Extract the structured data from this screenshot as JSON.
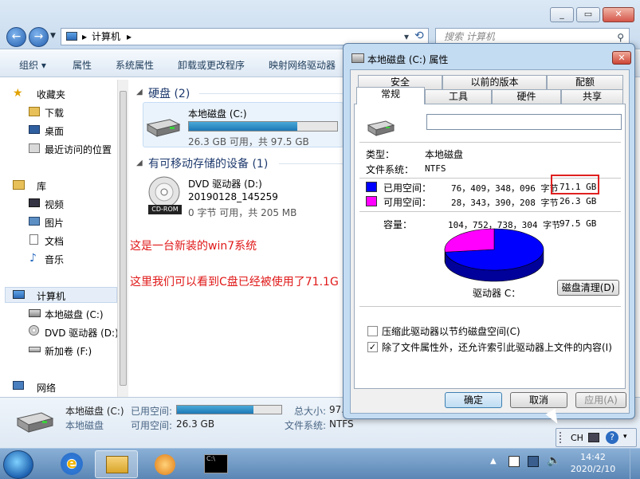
{
  "explorer": {
    "breadcrumb": "计算机",
    "search_placeholder": "搜索 计算机",
    "toolbar": [
      "组织 ▾",
      "属性",
      "系统属性",
      "卸载或更改程序",
      "映射网络驱动器"
    ],
    "nav": {
      "favorites": "收藏夹",
      "downloads": "下载",
      "desktop": "桌面",
      "recent": "最近访问的位置",
      "libraries": "库",
      "videos": "视频",
      "pictures": "图片",
      "documents": "文档",
      "music": "音乐",
      "computer": "计算机",
      "drive_c": "本地磁盘 (C:)",
      "drive_d": "DVD 驱动器 (D:)",
      "drive_f": "新加卷 (F:)",
      "network": "网络"
    },
    "groups": {
      "hdd": "硬盘 (2)",
      "removable": "有可移动存储的设备 (1)"
    },
    "drive_c": {
      "name": "本地磁盘 (C:)",
      "free_text": "26.3 GB 可用，共 97.5 GB",
      "used_fraction": 0.73
    },
    "drive_d": {
      "name": "DVD 驱动器 (D:)",
      "label": "20190128_145259",
      "free_text": "0 字节 可用，共 205 MB",
      "disc_caption": "CD-ROM"
    },
    "notes": [
      "这是一台新装的win7系统",
      "这里我们可以看到C盘已经被使用了71.1G"
    ],
    "details": {
      "name": "本地磁盘 (C:)",
      "type": "本地磁盘",
      "used_label": "已用空间:",
      "free_label": "可用空间:",
      "free_value": "26.3 GB",
      "total_label": "总大小:",
      "total_value": "97.",
      "fs_label": "文件系统:",
      "fs_value": "NTFS",
      "used_fraction": 0.73
    }
  },
  "dialog": {
    "title": "本地磁盘 (C:) 属性",
    "tabs_back": [
      "安全",
      "以前的版本",
      "配额"
    ],
    "tabs_front": [
      "常规",
      "工具",
      "硬件",
      "共享"
    ],
    "label_value": "",
    "type_label": "类型：",
    "type_value": "本地磁盘",
    "fs_label": "文件系统：",
    "fs_value": "NTFS",
    "used_label": "已用空间：",
    "used_bytes": "76，409，348，096 字节",
    "used_gb": "71.1 GB",
    "free_label": "可用空间：",
    "free_bytes": "28，343，390，208 字节",
    "free_gb": "26.3 GB",
    "cap_label": "容量：",
    "cap_bytes": "104，752，738，304 字节",
    "cap_gb": "97.5 GB",
    "drive_caption": "驱动器 C：",
    "cleanup_button": "磁盘清理(D)",
    "compress_label": "压缩此驱动器以节约磁盘空间(C)",
    "index_label": "除了文件属性外，还允许索引此驱动器上文件的内容(I)",
    "ok": "确定",
    "cancel": "取消",
    "apply": "应用(A)",
    "colors": {
      "used": "#0000ff",
      "free": "#ff00ff",
      "highlight": "#e02020"
    }
  },
  "chart_data": {
    "type": "pie",
    "categories": [
      "已用空间",
      "可用空间"
    ],
    "values": [
      76409348096,
      28343390208
    ],
    "colors": [
      "#0000ff",
      "#ff00ff"
    ]
  },
  "taskbar": {
    "lang": "CH",
    "time": "14:42",
    "date": "2020/2/10"
  }
}
